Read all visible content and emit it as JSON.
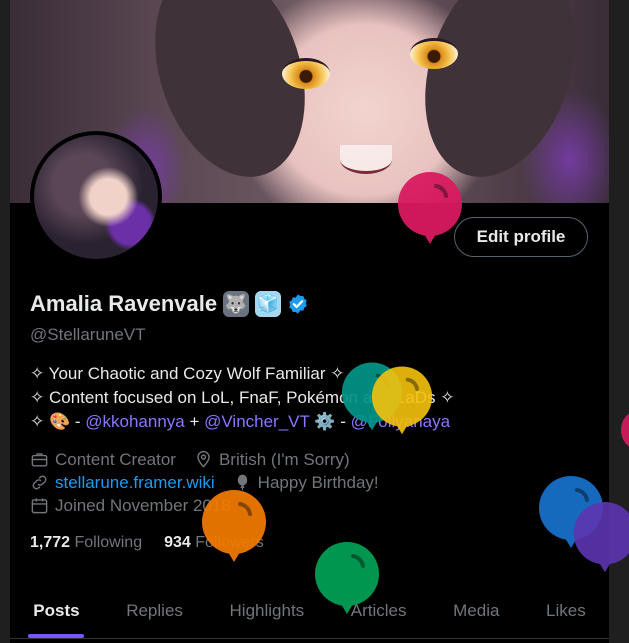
{
  "profile": {
    "display_name": "Amalia Ravenvale",
    "name_emojis": [
      "🐺",
      "🧊"
    ],
    "handle": "@StellaruneVT",
    "edit_button": "Edit profile"
  },
  "bio": {
    "line1": "✧ Your Chaotic and Cozy Wolf Familiar ✧",
    "line2": "✧ Content focused on LoL, FnaF, Pokémon and LaDs ✧",
    "line3_prefix": "✧ 🎨 - ",
    "mention1": "@kkohannya",
    "line3_plus": " + ",
    "mention2": "@Vincher_VT",
    "line3_gear": " ⚙️ - ",
    "mention3": "@Follyanaya"
  },
  "meta": {
    "category": "Content Creator",
    "location": "British (I'm Sorry)",
    "website": "stellarune.framer.wiki",
    "birthday": "Happy Birthday!",
    "joined": "Joined November 2018"
  },
  "stats": {
    "following_count": "1,772",
    "following_label": "Following",
    "followers_count": "934",
    "followers_label": "Followers"
  },
  "tabs": [
    "Posts",
    "Replies",
    "Highlights",
    "Articles",
    "Media",
    "Likes"
  ],
  "active_tab": "Posts",
  "colors": {
    "accent": "#7856ff",
    "verified": "#1d9bf0",
    "balloons": [
      "#d81b60",
      "#009688",
      "#f4c20d",
      "#f57c00",
      "#009f55",
      "#1976d2",
      "#5e35b1"
    ]
  }
}
